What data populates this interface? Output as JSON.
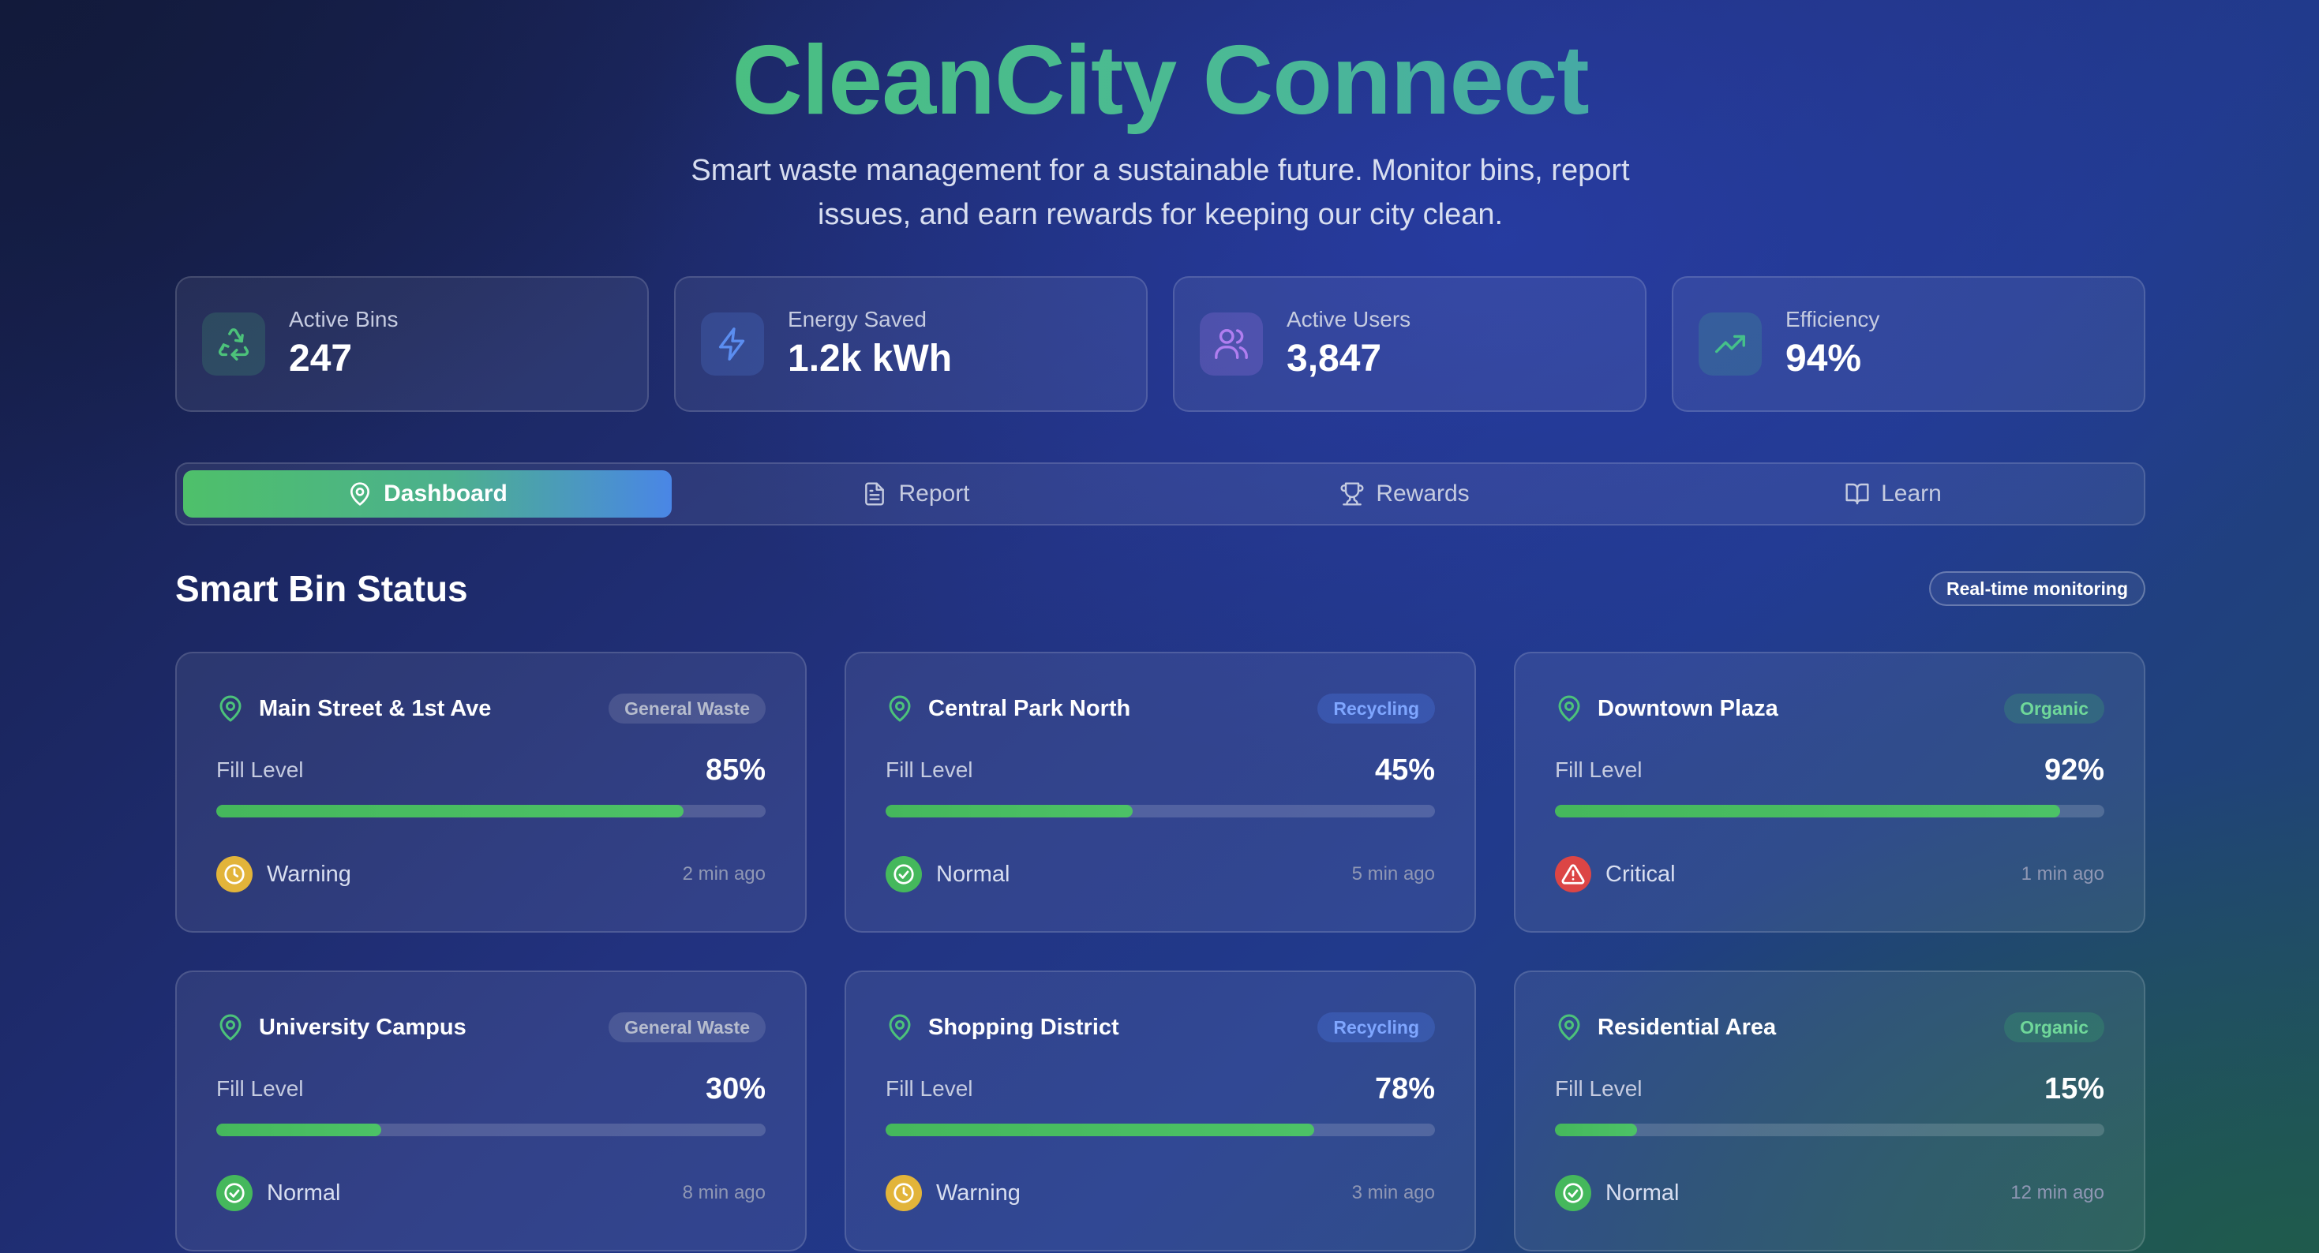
{
  "hero": {
    "title": "CleanCity Connect",
    "subtitle": "Smart waste management for a sustainable future. Monitor bins, report issues, and earn rewards for keeping our city clean."
  },
  "stats": [
    {
      "label": "Active Bins",
      "value": "247",
      "icon": "recycle-icon",
      "color": "#4cc27a"
    },
    {
      "label": "Energy Saved",
      "value": "1.2k kWh",
      "icon": "lightning-icon",
      "color": "#5b8df0"
    },
    {
      "label": "Active Users",
      "value": "3,847",
      "icon": "users-icon",
      "color": "#b07ef0"
    },
    {
      "label": "Efficiency",
      "value": "94%",
      "icon": "trending-up-icon",
      "color": "#45c08a"
    }
  ],
  "tabs": [
    {
      "label": "Dashboard",
      "icon": "map-pin-icon",
      "active": true
    },
    {
      "label": "Report",
      "icon": "document-icon",
      "active": false
    },
    {
      "label": "Rewards",
      "icon": "trophy-icon",
      "active": false
    },
    {
      "label": "Learn",
      "icon": "book-open-icon",
      "active": false
    }
  ],
  "section": {
    "title": "Smart Bin Status",
    "badge": "Real-time monitoring"
  },
  "fill_label": "Fill Level",
  "bins": [
    {
      "name": "Main Street & 1st Ave",
      "type": "General Waste",
      "fill": "85%",
      "fill_fraction": 0.85,
      "status": "Warning",
      "time": "2 min ago"
    },
    {
      "name": "Central Park North",
      "type": "Recycling",
      "fill": "45%",
      "fill_fraction": 0.45,
      "status": "Normal",
      "time": "5 min ago"
    },
    {
      "name": "Downtown Plaza",
      "type": "Organic",
      "fill": "92%",
      "fill_fraction": 0.92,
      "status": "Critical",
      "time": "1 min ago"
    },
    {
      "name": "University Campus",
      "type": "General Waste",
      "fill": "30%",
      "fill_fraction": 0.3,
      "status": "Normal",
      "time": "8 min ago"
    },
    {
      "name": "Shopping District",
      "type": "Recycling",
      "fill": "78%",
      "fill_fraction": 0.78,
      "status": "Warning",
      "time": "3 min ago"
    },
    {
      "name": "Residential Area",
      "type": "Organic",
      "fill": "15%",
      "fill_fraction": 0.15,
      "status": "Normal",
      "time": "12 min ago"
    }
  ]
}
